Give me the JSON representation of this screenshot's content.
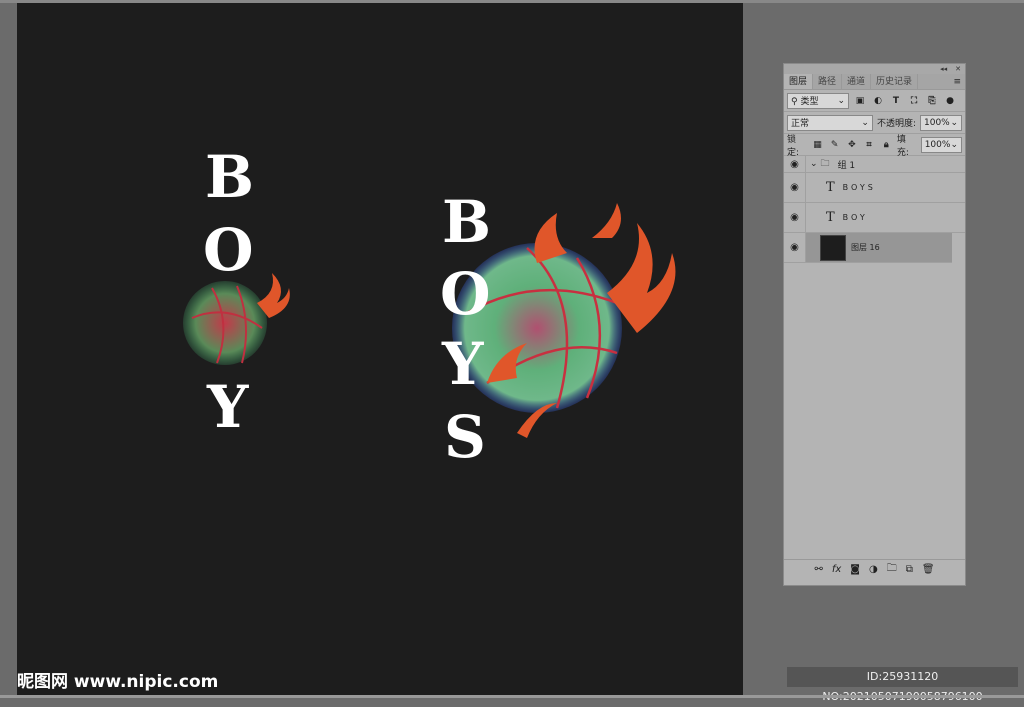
{
  "artwork": {
    "left_letters": [
      "B",
      "O",
      "Y"
    ],
    "right_letters": [
      "B",
      "O",
      "Y",
      "S"
    ]
  },
  "watermark": "昵图网 www.nipic.com",
  "id_text": "ID:25931120 NO:20210507190058796100",
  "panel": {
    "tabs": [
      "图层",
      "路径",
      "通道",
      "历史记录"
    ],
    "filter_kind": "类型",
    "blend_mode": "正常",
    "opacity_label": "不透明度:",
    "opacity": "100%",
    "lock_label": "锁定:",
    "fill_label": "填充:",
    "fill": "100%",
    "layers": [
      {
        "name": "组 1",
        "type": "group"
      },
      {
        "name": "BOYS",
        "type": "text"
      },
      {
        "name": "BOY",
        "type": "text"
      },
      {
        "name": "图层 16",
        "type": "pixel",
        "selected": true
      }
    ]
  }
}
